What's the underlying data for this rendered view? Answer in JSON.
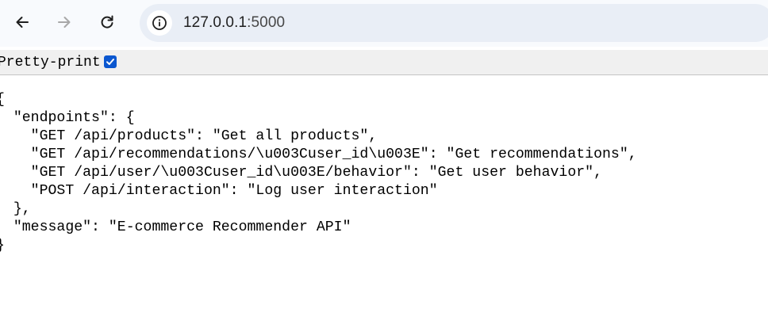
{
  "browser": {
    "back_icon": "arrow-left-icon",
    "forward_icon": "arrow-right-icon",
    "reload_icon": "reload-icon",
    "site_info_icon": "info-icon",
    "url_host": "127.0.0.1",
    "url_port": ":5000"
  },
  "pretty_print": {
    "label": "Pretty-print",
    "checked": true
  },
  "json_lines": [
    "{",
    "  \"endpoints\": {",
    "    \"GET /api/products\": \"Get all products\",",
    "    \"GET /api/recommendations/\\u003Cuser_id\\u003E\": \"Get recommendations\",",
    "    \"GET /api/user/\\u003Cuser_id\\u003E/behavior\": \"Get user behavior\",",
    "    \"POST /api/interaction\": \"Log user interaction\"",
    "  },",
    "  \"message\": \"E-commerce Recommender API\"",
    "}"
  ],
  "colors": {
    "toolbar_bg": "#f8fafd",
    "omnibox_bg": "#e9eef6",
    "checkbox_accent": "#0b57d0",
    "pretty_print_bar_bg": "#f0f0f0"
  }
}
